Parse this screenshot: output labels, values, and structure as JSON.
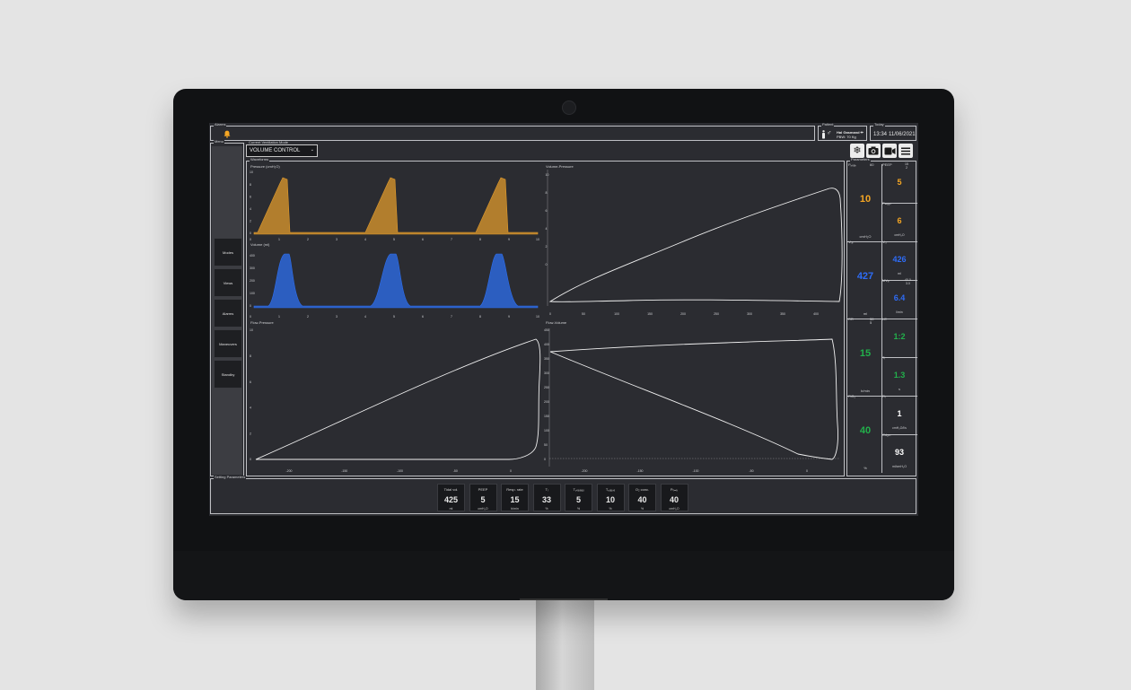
{
  "colors": {
    "pressure": "#e09a2c",
    "volume": "#2d6ff0",
    "orange": "#f5a623",
    "blue": "#2e6cf6",
    "green": "#22b04b"
  },
  "icons": [
    "bell-icon",
    "snowflake-icon",
    "camera-icon",
    "video-camera-icon",
    "hamburger-menu-icon",
    "male-gender-icon",
    "person-icon"
  ],
  "alarms": {
    "legend": "Alarms"
  },
  "patient": {
    "legend": "Patient",
    "name": "Hal Gasmand ✏",
    "pbw": "PBW: 70 Kg"
  },
  "today": {
    "legend": "Today",
    "time": "13:34",
    "date": "11/06/2021"
  },
  "menu": {
    "legend": "Menu",
    "items": [
      "Modes",
      "Views",
      "Alarms",
      "Maneuvers",
      "Standby"
    ]
  },
  "mode": {
    "legend": "Current Ventilation Mode",
    "value": "VOLUME CONTROL",
    "chevron": "⌄"
  },
  "waveforms": {
    "legend": "Waveforms",
    "pressure": {
      "title": "Pressure (cmH₂O)",
      "yticks": [
        "10",
        "8",
        "6",
        "4",
        "2",
        "0"
      ],
      "xticks": [
        "0",
        "1",
        "2",
        "3",
        "4",
        "5",
        "6",
        "7",
        "8",
        "9",
        "10"
      ],
      "color": "#e09a2c"
    },
    "volume": {
      "title": "Volume (ml)",
      "yticks": [
        "400",
        "300",
        "200",
        "100",
        "0"
      ],
      "xticks": [
        "0",
        "1",
        "2",
        "3",
        "4",
        "5",
        "6",
        "7",
        "8",
        "9",
        "10"
      ],
      "color": "#2d6ff0"
    },
    "volume_pressure": {
      "title": "Volume-Pressure",
      "yticks": [
        "10",
        "8",
        "6",
        "4",
        "2",
        "0"
      ],
      "xticks": [
        "0",
        "50",
        "100",
        "150",
        "200",
        "250",
        "300",
        "350",
        "400"
      ]
    },
    "flow_pressure": {
      "title": "Flow-Pressure",
      "yticks": [
        "10",
        "8",
        "6",
        "4",
        "2",
        "0"
      ],
      "xticks": [
        "-200",
        "-150",
        "-100",
        "-50",
        "0"
      ]
    },
    "flow_volume": {
      "title": "Flow-Volume",
      "yticks": [
        "450",
        "400",
        "350",
        "300",
        "250",
        "200",
        "150",
        "100",
        "50",
        "0"
      ],
      "xticks": [
        "-200",
        "-150",
        "-100",
        "-50",
        "0"
      ]
    }
  },
  "parameters": {
    "legend": "Parameters",
    "left": [
      {
        "label": "Pₚₑₐₖ",
        "limit_hi": "60",
        "limit_lo": "",
        "value": "10",
        "unit": "cmH₂O",
        "color": "orange"
      },
      {
        "label": "Vₜₑ",
        "limit_hi": "",
        "limit_lo": "",
        "value": "427",
        "unit": "ml",
        "color": "blue"
      },
      {
        "label": "RR",
        "limit_hi": "30",
        "limit_lo": "5",
        "value": "15",
        "unit": "b/min",
        "color": "green"
      },
      {
        "label": "FiO₂",
        "limit_hi": "",
        "limit_lo": "",
        "value": "40",
        "unit": "%",
        "color": "green"
      }
    ],
    "right": [
      {
        "label": "PEEP",
        "limit_hi": "15",
        "limit_lo": "2",
        "value": "5",
        "unit": "",
        "color": "orange"
      },
      {
        "label": "Pₘₑₐₙ",
        "limit_hi": "",
        "limit_lo": "",
        "value": "6",
        "unit": "cmH₂O",
        "color": "orange"
      },
      {
        "label": "Vₜᵢ",
        "limit_hi": "",
        "limit_lo": "",
        "value": "426",
        "unit": "ml",
        "color": "blue"
      },
      {
        "label": "MVₑ",
        "limit_hi": "40.0",
        "limit_lo": "3.0",
        "value": "6.4",
        "unit": "l/min",
        "color": "blue"
      },
      {
        "label": "I:E",
        "limit_hi": "",
        "limit_lo": "",
        "value": "1:2",
        "unit": "",
        "color": "green"
      },
      {
        "label": "Tᵢ",
        "limit_hi": "",
        "limit_lo": "",
        "value": "1.3",
        "unit": "s",
        "color": "green"
      },
      {
        "label": "Rᵢ",
        "limit_hi": "",
        "limit_lo": "",
        "value": "1",
        "unit": "cmH₂O/l/s",
        "color": "white"
      },
      {
        "label": "Cdyn",
        "limit_hi": "",
        "limit_lo": "",
        "value": "93",
        "unit": "ml/cmH₂O",
        "color": "white"
      }
    ]
  },
  "settings": {
    "legend": "Setting Parameters",
    "tiles": [
      {
        "label": "Tidal vol.",
        "value": "425",
        "unit": "ml"
      },
      {
        "label": "PEEP",
        "value": "5",
        "unit": "cmH₂O"
      },
      {
        "label": "Resp. rate",
        "value": "15",
        "unit": "b/min"
      },
      {
        "label": "Tᵢ",
        "value": "33",
        "unit": "%"
      },
      {
        "label": "Tₚₗₐₜₑₐᵤ",
        "value": "5",
        "unit": "%"
      },
      {
        "label": "Tₚₐᵤₛₑ",
        "value": "10",
        "unit": "%"
      },
      {
        "label": "O₂ conc.",
        "value": "40",
        "unit": "%"
      },
      {
        "label": "Pₗᵢₘᵢₜ",
        "value": "40",
        "unit": "cmH₂O"
      }
    ]
  }
}
